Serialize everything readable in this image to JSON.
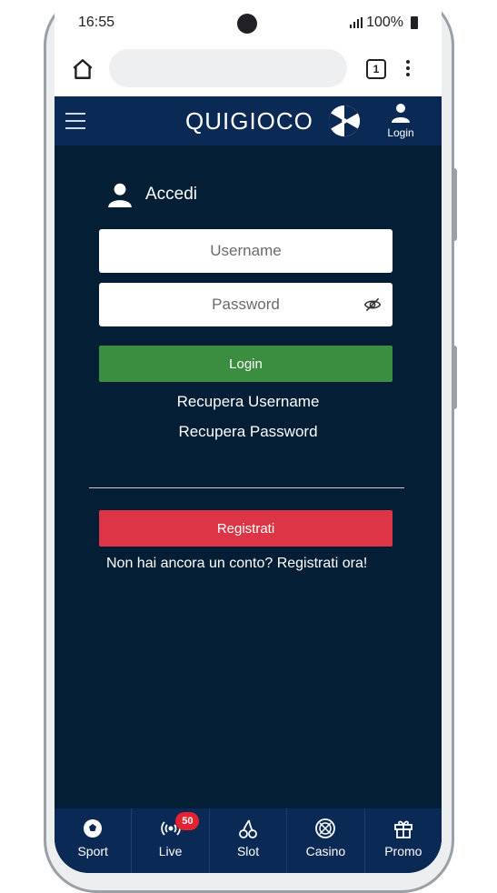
{
  "status_bar": {
    "time": "16:55",
    "battery": "100%"
  },
  "browser": {
    "tab_count": "1"
  },
  "header": {
    "logo": "QUIGIOCO",
    "login_label": "Login"
  },
  "form": {
    "title": "Accedi",
    "username_placeholder": "Username",
    "password_placeholder": "Password",
    "login_button": "Login",
    "recover_username": "Recupera Username",
    "recover_password": "Recupera Password",
    "register_button": "Registrati",
    "register_prompt": "Non hai ancora un conto? Registrati ora!"
  },
  "bottom_nav": {
    "items": [
      {
        "label": "Sport",
        "icon": "soccer-ball-icon"
      },
      {
        "label": "Live",
        "icon": "live-broadcast-icon",
        "badge": "50"
      },
      {
        "label": "Slot",
        "icon": "cherries-icon"
      },
      {
        "label": "Casino",
        "icon": "roulette-icon"
      },
      {
        "label": "Promo",
        "icon": "gift-icon"
      }
    ]
  },
  "colors": {
    "background": "#041e36",
    "nav": "#0a2a55",
    "login_button": "#3b8d3f",
    "register_button": "#dc3545",
    "badge": "#e3232f"
  }
}
